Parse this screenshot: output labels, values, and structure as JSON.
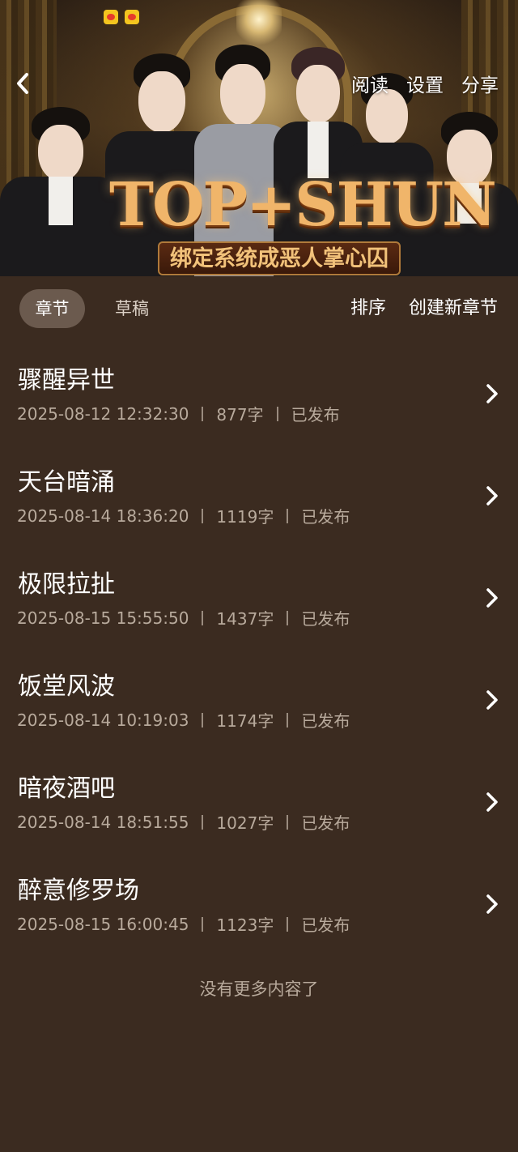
{
  "header": {
    "back_icon": "chevron-left-icon",
    "actions": [
      "阅读",
      "设置",
      "分享"
    ]
  },
  "banner": {
    "logo_title": "TOP+SHUN",
    "logo_subtitle": "绑定系统成恶人掌心囚"
  },
  "tabs": {
    "active": "章节",
    "inactive": "草稿",
    "sort": "排序",
    "create": "创建新章节"
  },
  "chapters": [
    {
      "title": "骤醒异世",
      "date": "2025-08-12 12:32:30",
      "words": "877字",
      "status": "已发布"
    },
    {
      "title": "天台暗涌",
      "date": "2025-08-14 18:36:20",
      "words": "1119字",
      "status": "已发布"
    },
    {
      "title": "极限拉扯",
      "date": "2025-08-15 15:55:50",
      "words": "1437字",
      "status": "已发布"
    },
    {
      "title": "饭堂风波",
      "date": "2025-08-14 10:19:03",
      "words": "1174字",
      "status": "已发布"
    },
    {
      "title": "暗夜酒吧",
      "date": "2025-08-14 18:51:55",
      "words": "1027字",
      "status": "已发布"
    },
    {
      "title": "醉意修罗场",
      "date": "2025-08-15 16:00:45",
      "words": "1123字",
      "status": "已发布"
    }
  ],
  "footer": {
    "end_note": "没有更多内容了"
  },
  "colors": {
    "background": "#3b2b20",
    "active_tab": "#6b5a4e",
    "meta_text": "#b8aa9c"
  }
}
